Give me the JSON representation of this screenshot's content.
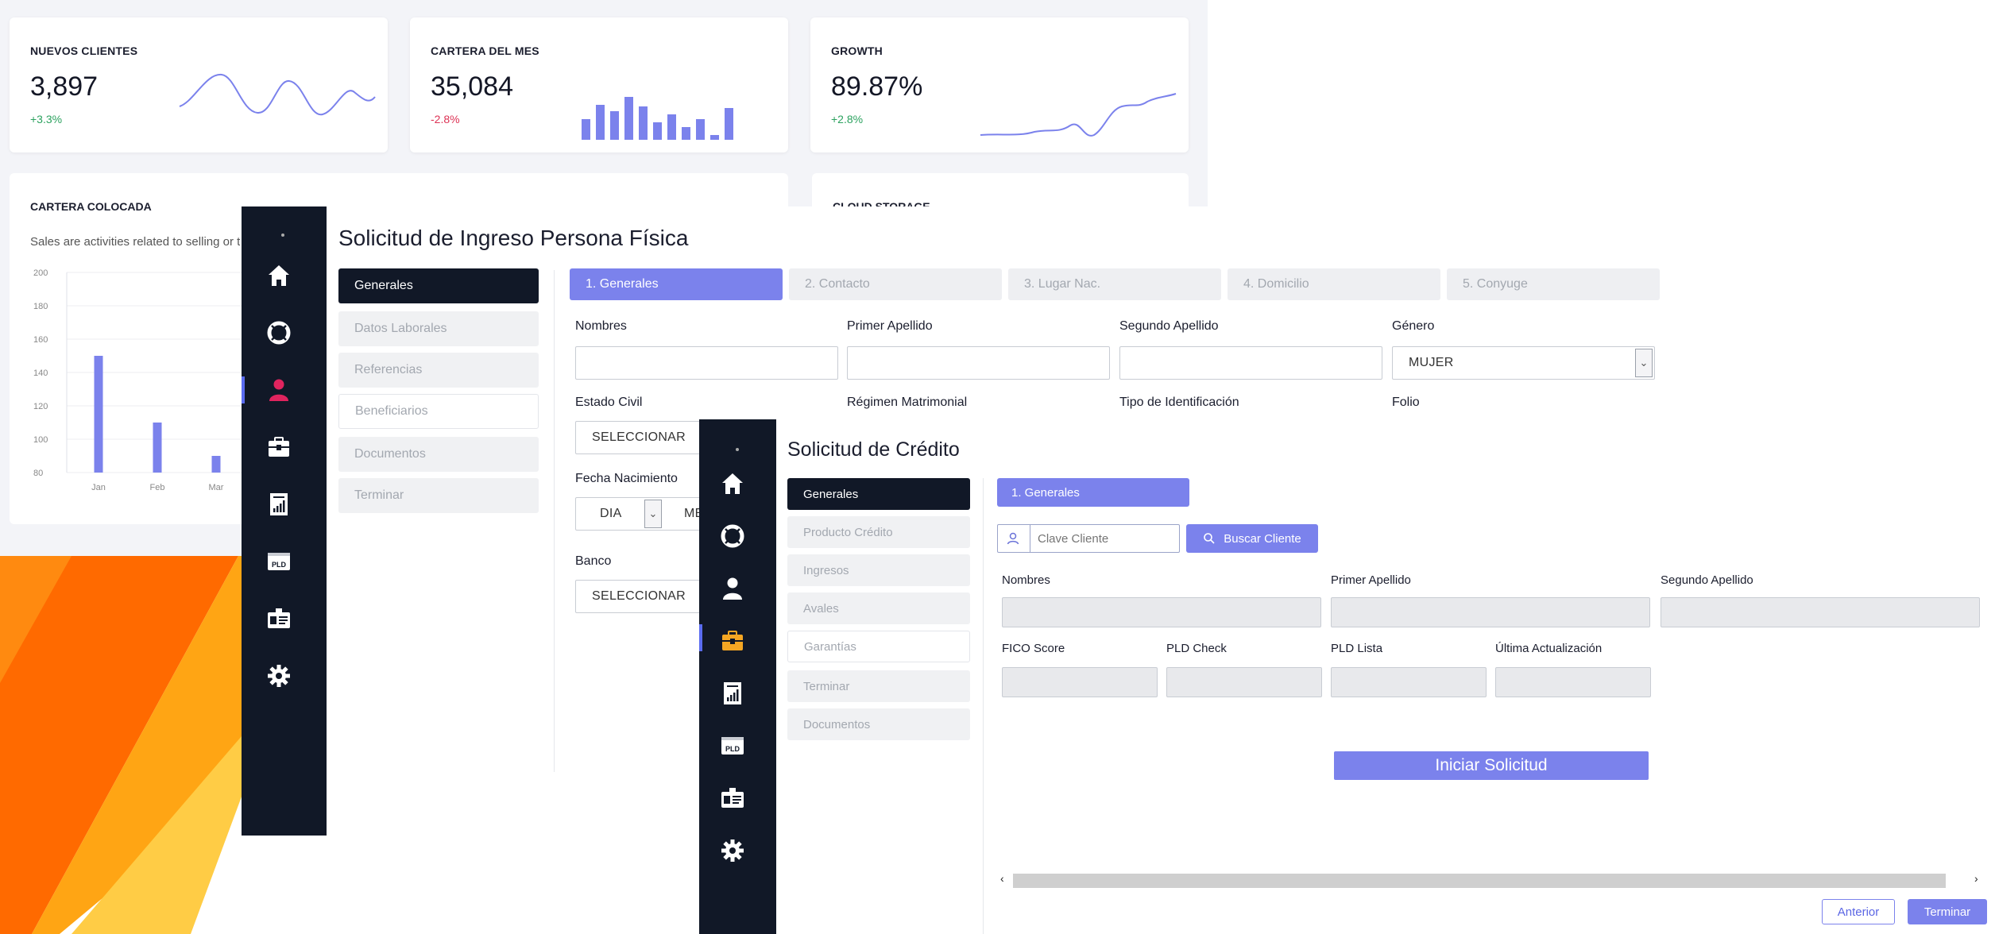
{
  "colors": {
    "accent": "#7b82ec",
    "sidebar": "#111827",
    "positive": "#2ca25f",
    "negative": "#dd3355",
    "orange": "#ff7a00",
    "yellow": "#ffc940"
  },
  "dashboard": {
    "cards": [
      {
        "title": "NUEVOS CLIENTES",
        "value": "3,897",
        "delta": "+3.3%"
      },
      {
        "title": "CARTERA DEL MES",
        "value": "35,084",
        "delta": "-2.8%"
      },
      {
        "title": "GROWTH",
        "value": "89.87%",
        "delta": "+2.8%"
      }
    ],
    "big_card": {
      "title": "CARTERA COLOCADA",
      "subtitle": "Sales are activities related to selling or t"
    },
    "cloud_card": {
      "title": "CLOUD STORAGE"
    }
  },
  "chart_data": {
    "type": "bar",
    "categories": [
      "Jan",
      "Feb",
      "Mar"
    ],
    "values": [
      150,
      110,
      90
    ],
    "ylim": [
      80,
      200
    ],
    "yticks": [
      80,
      100,
      120,
      140,
      160,
      180,
      200
    ]
  },
  "sidebar": {
    "icons": [
      "home-icon",
      "lifebuoy-icon",
      "user-icon",
      "briefcase-icon",
      "report-icon",
      "pld-icon",
      "id-card-icon",
      "gear-icon"
    ],
    "pld_label": "PLD"
  },
  "window1": {
    "title": "Solicitud de Ingreso Persona Física",
    "side_menu": [
      "Generales",
      "Datos Laborales",
      "Referencias",
      "Beneficiarios",
      "Documentos",
      "Terminar"
    ],
    "tabs": [
      "1. Generales",
      "2. Contacto",
      "3. Lugar Nac.",
      "4. Domicilio",
      "5. Conyuge"
    ],
    "labels": {
      "nombres": "Nombres",
      "primer_apellido": "Primer Apellido",
      "segundo_apellido": "Segundo Apellido",
      "genero": "Género",
      "estado_civil": "Estado Civil",
      "regimen": "Régimen Matrimonial",
      "tipo_id": "Tipo de Identificación",
      "folio": "Folio",
      "fecha_nacimiento": "Fecha Nacimiento",
      "banco": "Banco"
    },
    "values": {
      "genero": "MUJER",
      "estado_civil": "SELECCIONAR",
      "dia": "DIA",
      "mes": "ME",
      "banco": "SELECCIONAR"
    }
  },
  "window2": {
    "title": "Solicitud de Crédito",
    "side_menu": [
      "Generales",
      "Producto Crédito",
      "Ingresos",
      "Avales",
      "Garantías",
      "Terminar",
      "Documentos"
    ],
    "tab": "1. Generales",
    "search_placeholder": "Clave Cliente",
    "search_button": "Buscar Cliente",
    "labels": {
      "nombres": "Nombres",
      "primer_apellido": "Primer Apellido",
      "segundo_apellido": "Segundo Apellido",
      "fico": "FICO Score",
      "pld_check": "PLD Check",
      "pld_lista": "PLD Lista",
      "ultima": "Última Actualización"
    },
    "start_button": "Iniciar Solicitud",
    "prev_button": "Anterior",
    "finish_button": "Terminar"
  }
}
